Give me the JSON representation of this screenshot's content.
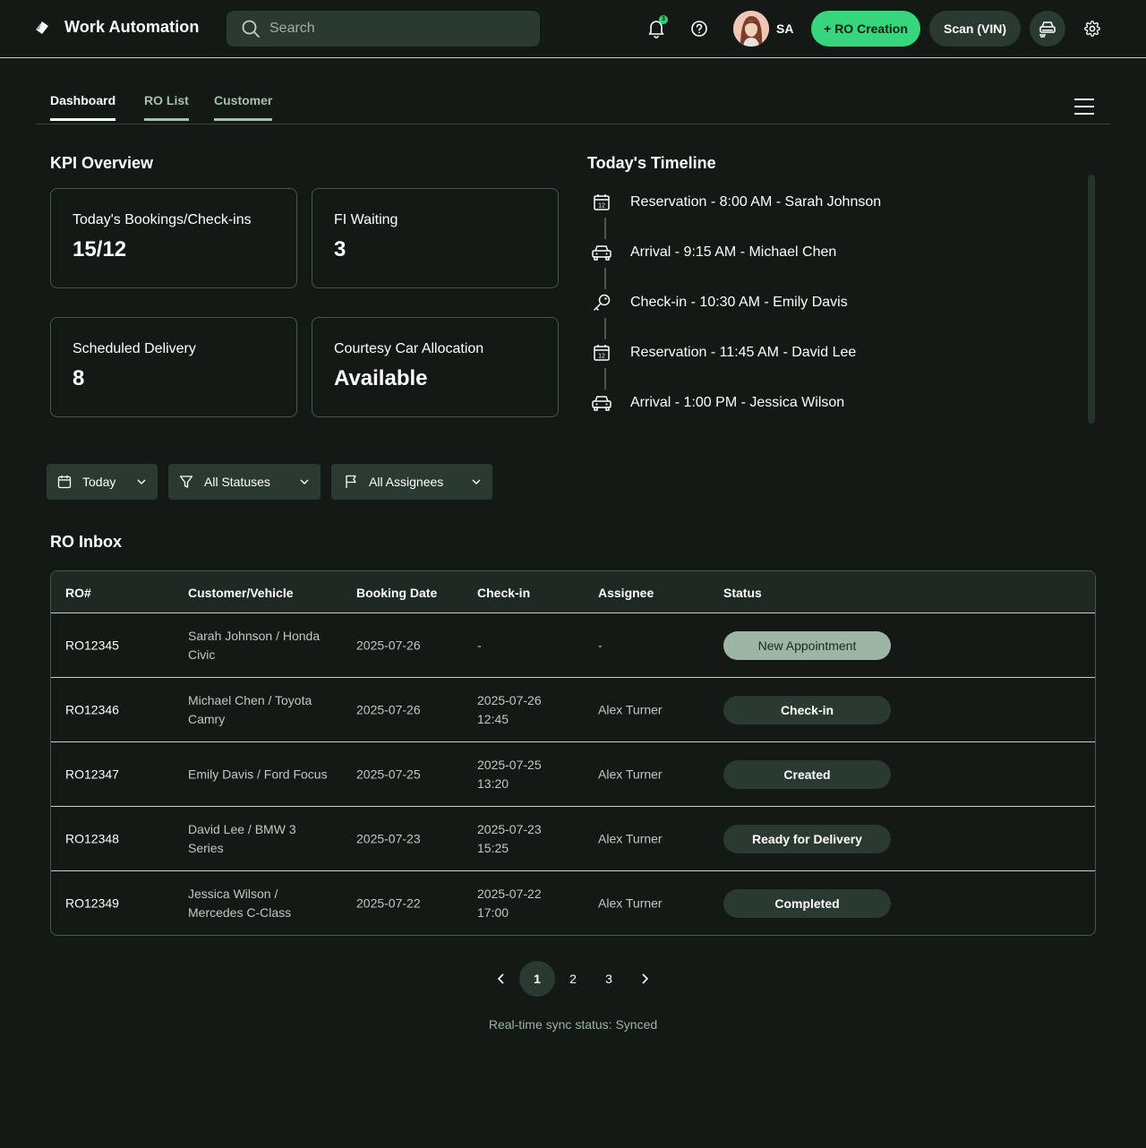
{
  "app": {
    "title": "Work Automation",
    "search_placeholder": "Search",
    "notification_count": "3",
    "user_initials": "SA",
    "ro_creation_label": "+ RO Creation",
    "scan_label": "Scan (VIN)"
  },
  "tabs": [
    {
      "label": "Dashboard",
      "active": true
    },
    {
      "label": "RO List",
      "active": false
    },
    {
      "label": "Customer",
      "active": false
    }
  ],
  "kpi": {
    "title": "KPI Overview",
    "cards": [
      {
        "label": "Today's Bookings/Check-ins",
        "value": "15/12"
      },
      {
        "label": "FI Waiting",
        "value": "3"
      },
      {
        "label": "Scheduled Delivery",
        "value": "8"
      },
      {
        "label": "Courtesy Car Allocation",
        "value": "Available"
      }
    ]
  },
  "timeline": {
    "title": "Today's Timeline",
    "items": [
      {
        "icon": "calendar-icon",
        "text": "Reservation - 8:00 AM - Sarah Johnson"
      },
      {
        "icon": "car-icon",
        "text": "Arrival - 9:15 AM - Michael Chen"
      },
      {
        "icon": "key-icon",
        "text": "Check-in - 10:30 AM - Emily Davis"
      },
      {
        "icon": "calendar-icon",
        "text": "Reservation - 11:45 AM - David Lee"
      },
      {
        "icon": "car-icon",
        "text": "Arrival - 1:00 PM - Jessica Wilson"
      }
    ]
  },
  "filters": {
    "date": "Today",
    "status": "All Statuses",
    "assignee": "All Assignees"
  },
  "inbox": {
    "title": "RO Inbox",
    "columns": [
      "RO#",
      "Customer/Vehicle",
      "Booking Date",
      "Check-in",
      "Assignee",
      "Status"
    ],
    "rows": [
      {
        "ro": "RO12345",
        "customer_l1": "Sarah Johnson / Honda",
        "customer_l2": "Civic",
        "booking": "2025-07-26",
        "checkin_l1": "-",
        "checkin_l2": "",
        "assignee": "-",
        "status": "New Appointment"
      },
      {
        "ro": "RO12346",
        "customer_l1": "Michael Chen / Toyota",
        "customer_l2": "Camry",
        "booking": "2025-07-26",
        "checkin_l1": "2025-07-26",
        "checkin_l2": "12:45",
        "assignee": "Alex Turner",
        "status": "Check-in"
      },
      {
        "ro": "RO12347",
        "customer_l1": "Emily Davis / Ford Focus",
        "customer_l2": "",
        "booking": "2025-07-25",
        "checkin_l1": "2025-07-25",
        "checkin_l2": "13:20",
        "assignee": "Alex Turner",
        "status": "Created"
      },
      {
        "ro": "RO12348",
        "customer_l1": "David Lee / BMW 3",
        "customer_l2": "Series",
        "booking": "2025-07-23",
        "checkin_l1": "2025-07-23",
        "checkin_l2": "15:25",
        "assignee": "Alex Turner",
        "status": "Ready for Delivery"
      },
      {
        "ro": "RO12349",
        "customer_l1": "Jessica Wilson /",
        "customer_l2": "Mercedes C-Class",
        "booking": "2025-07-22",
        "checkin_l1": "2025-07-22",
        "checkin_l2": "17:00",
        "assignee": "Alex Turner",
        "status": "Completed"
      }
    ]
  },
  "pagination": {
    "pages": [
      "1",
      "2",
      "3"
    ],
    "current": "1"
  },
  "sync_status": "Real-time sync status: Synced",
  "colors": {
    "background": "#131915",
    "surface": "#2a3a30",
    "accent": "#36d67c",
    "status_new": "#9cb5a4"
  }
}
